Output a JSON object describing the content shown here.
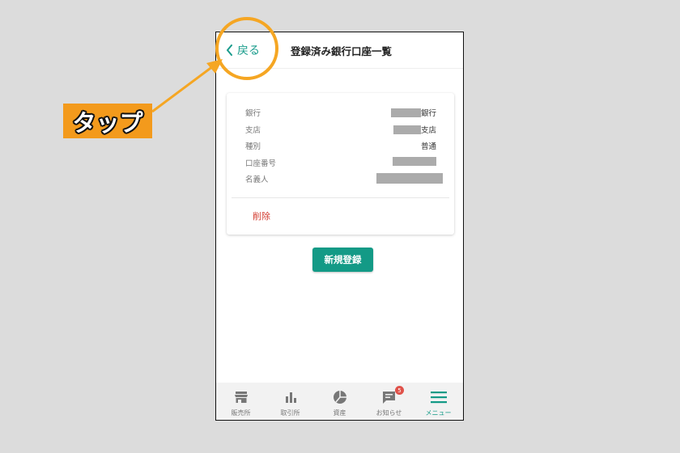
{
  "header": {
    "back_label": "戻る",
    "title": "登録済み銀行口座一覧"
  },
  "account": {
    "rows": [
      {
        "label": "銀行",
        "suffix": "銀行"
      },
      {
        "label": "支店",
        "suffix": "支店"
      },
      {
        "label": "種別",
        "value": "普通"
      },
      {
        "label": "口座番号"
      },
      {
        "label": "名義人"
      }
    ],
    "delete_label": "削除"
  },
  "register_label": "新規登録",
  "tabbar": {
    "items": [
      {
        "label": "販売所",
        "icon": "store-icon"
      },
      {
        "label": "取引所",
        "icon": "bar-chart-icon"
      },
      {
        "label": "資産",
        "icon": "pie-chart-icon"
      },
      {
        "label": "お知らせ",
        "icon": "chat-icon",
        "badge": "5"
      },
      {
        "label": "メニュー",
        "icon": "menu-icon"
      }
    ]
  },
  "annotation": {
    "callout_label": "タップ"
  },
  "colors": {
    "accent": "#139a86",
    "danger": "#d23b2e",
    "callout": "#f39a1c",
    "highlight": "#f5a623"
  }
}
